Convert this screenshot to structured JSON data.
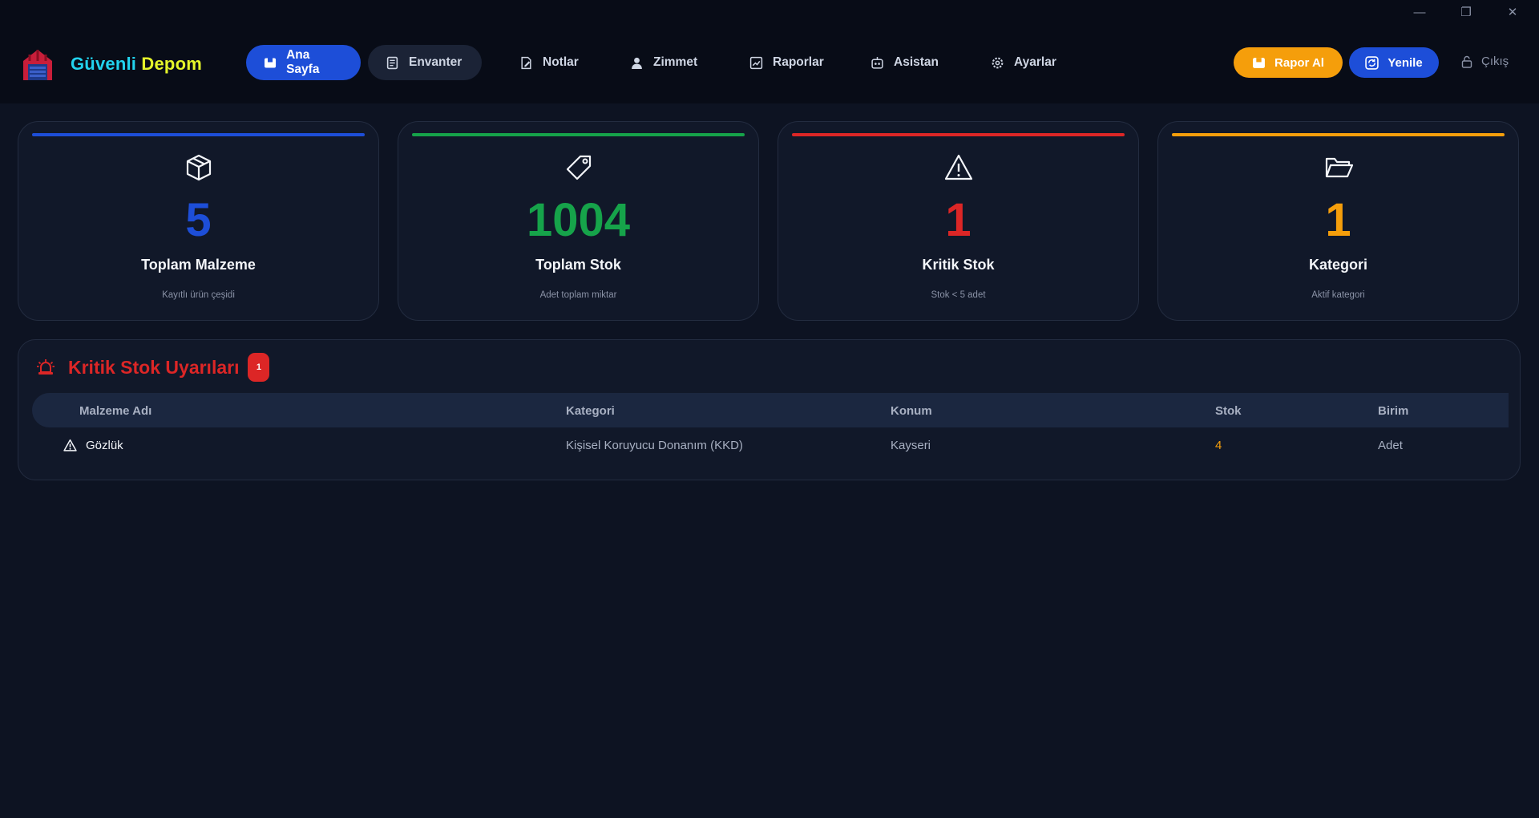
{
  "window": {
    "minimize": "—",
    "maximize": "❐",
    "close": "✕"
  },
  "brand": {
    "part1": "Güvenli",
    "part2": "Depom",
    "logo": "warehouse-logo"
  },
  "nav": {
    "home": "Ana Sayfa",
    "inventory": "Envanter",
    "notes": "Notlar",
    "assignment": "Zimmet",
    "reports": "Raporlar",
    "assistant": "Asistan",
    "settings": "Ayarlar"
  },
  "actions": {
    "report": "Rapor Al",
    "refresh": "Yenile",
    "logout": "Çıkış"
  },
  "stats": [
    {
      "value": "5",
      "label": "Toplam Malzeme",
      "sub": "Kayıtlı ürün çeşidi",
      "color": "#1d4ed8",
      "icon": "box-icon"
    },
    {
      "value": "1004",
      "label": "Toplam Stok",
      "sub": "Adet toplam miktar",
      "color": "#16a34a",
      "icon": "tag-icon"
    },
    {
      "value": "1",
      "label": "Kritik Stok",
      "sub": "Stok < 5 adet",
      "color": "#dc2626",
      "icon": "warning-icon"
    },
    {
      "value": "1",
      "label": "Kategori",
      "sub": "Aktif kategori",
      "color": "#f59e0b",
      "icon": "folder-icon"
    }
  ],
  "alerts": {
    "title": "Kritik Stok Uyarıları",
    "count": "1",
    "columns": [
      "Malzeme Adı",
      "Kategori",
      "Konum",
      "Stok",
      "Birim"
    ],
    "rows": [
      {
        "name": "Gözlük",
        "category": "Kişisel Koruyucu Donanım (KKD)",
        "location": "Kayseri",
        "stock": "4",
        "unit": "Adet"
      }
    ]
  }
}
